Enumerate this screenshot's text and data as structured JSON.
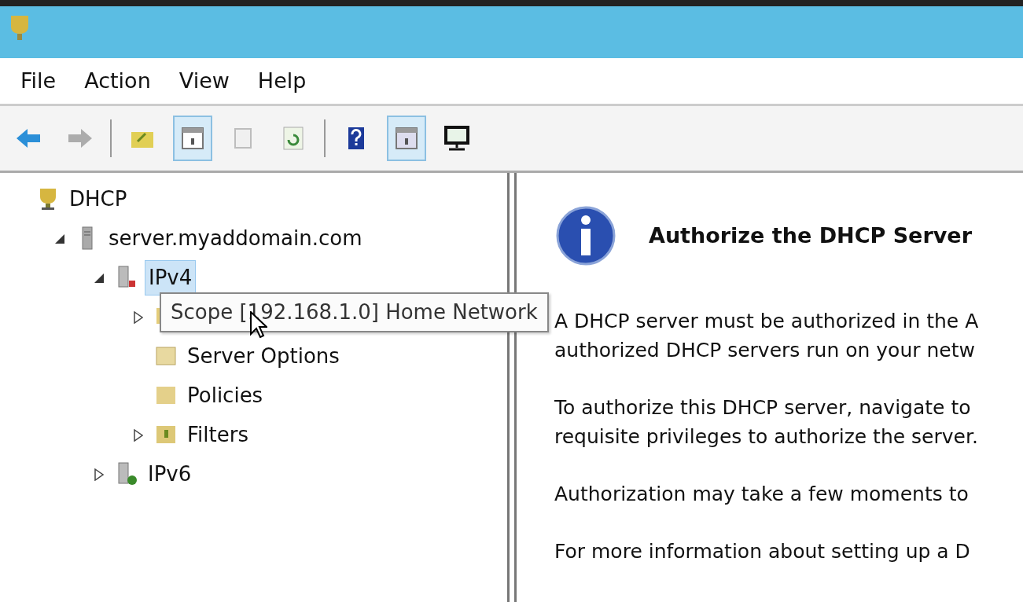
{
  "window": {
    "title_bar": true
  },
  "menu": [
    "File",
    "Action",
    "View",
    "Help"
  ],
  "toolbar": [
    {
      "kind": "back",
      "pressed": false,
      "disabled": false
    },
    {
      "kind": "forward",
      "pressed": false,
      "disabled": true
    },
    {
      "kind": "separator"
    },
    {
      "kind": "up",
      "pressed": false,
      "disabled": false
    },
    {
      "kind": "tree",
      "pressed": true,
      "disabled": false
    },
    {
      "kind": "properties",
      "pressed": false,
      "disabled": true
    },
    {
      "kind": "refresh",
      "pressed": false,
      "disabled": false
    },
    {
      "kind": "separator"
    },
    {
      "kind": "help",
      "pressed": false,
      "disabled": false
    },
    {
      "kind": "pane",
      "pressed": true,
      "disabled": false
    },
    {
      "kind": "monitor",
      "pressed": false,
      "disabled": false
    }
  ],
  "tree": [
    {
      "kind": "dhcp",
      "label": "DHCP",
      "selected": false,
      "children": [
        {
          "kind": "server",
          "label": "server.myaddomain.com",
          "expanded": true,
          "selected": false,
          "children": [
            {
              "kind": "ipv4",
              "label": "IPv4",
              "expanded": true,
              "selected": true,
              "children": [
                {
                  "kind": "scope",
                  "expanded": false,
                  "selected": false
                },
                {
                  "kind": "options",
                  "label": "Server Options",
                  "selected": false
                },
                {
                  "kind": "policies",
                  "label": "Policies",
                  "selected": false
                },
                {
                  "kind": "filters",
                  "label": "Filters",
                  "expanded": false,
                  "selected": false
                }
              ]
            },
            {
              "kind": "ipv6",
              "label": "IPv6",
              "expanded": false,
              "selected": false
            }
          ]
        }
      ]
    }
  ],
  "tooltip": "Scope [192.168.1.0] Home Network",
  "details": {
    "title": "Authorize the DHCP Server",
    "paragraphs": [
      [
        "A DHCP server must be authorized in the A",
        "authorized DHCP servers run on your netw"
      ],
      [
        "To authorize this DHCP server, navigate to",
        "requisite privileges to authorize the server."
      ],
      [
        "Authorization may take a few moments to"
      ],
      [
        "For more information about setting up a D"
      ]
    ]
  }
}
